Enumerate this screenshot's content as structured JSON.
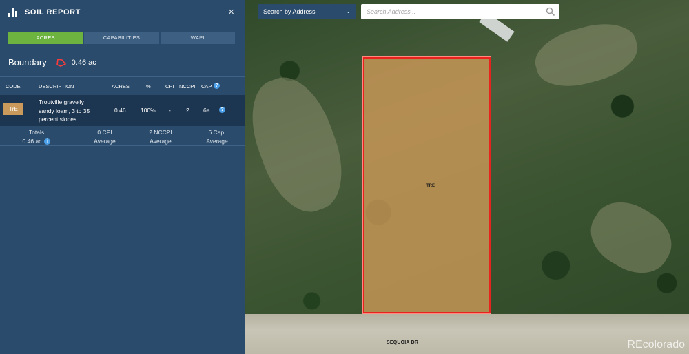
{
  "panel": {
    "title": "SOIL REPORT",
    "close_glyph": "×",
    "tabs": [
      {
        "label": "ACRES",
        "active": true
      },
      {
        "label": "CAPABILITIES",
        "active": false
      },
      {
        "label": "WAPI",
        "active": false
      }
    ],
    "boundary": {
      "label": "Boundary",
      "value": "0.46 ac",
      "icon": "boundary-polygon-icon"
    },
    "table": {
      "headers": {
        "code": "CODE",
        "description": "DESCRIPTION",
        "acres": "ACRES",
        "percent": "%",
        "cpi": "CPI",
        "nccpi": "NCCPI",
        "cap": "CAP",
        "cap_help_glyph": "?"
      },
      "rows": [
        {
          "code": "TrE",
          "description": "Troutville gravelly sandy loam, 3 to 35 percent slopes",
          "acres": "0.46",
          "percent": "100%",
          "cpi": "-",
          "nccpi": "2",
          "cap": "6e",
          "help_glyph": "?"
        }
      ]
    },
    "totals": {
      "label": "Totals",
      "acres": "0.46 ac",
      "info_glyph": "i",
      "cpi_value": "0 CPI",
      "cpi_label": "Average",
      "nccpi_value": "2 NCCPI",
      "nccpi_label": "Average",
      "cap_value": "6 Cap.",
      "cap_label": "Average"
    }
  },
  "map": {
    "search_mode": "Search by Address",
    "search_placeholder": "Search Address...",
    "parcel_label": "TRE",
    "road_label": "SEQUOIA DR",
    "watermark": "REcolorado"
  },
  "colors": {
    "panel_bg": "#2a4b6b",
    "tab_active": "#6cb33f",
    "parcel_border": "#e8221f",
    "soil_badge": "#c99a5b"
  }
}
